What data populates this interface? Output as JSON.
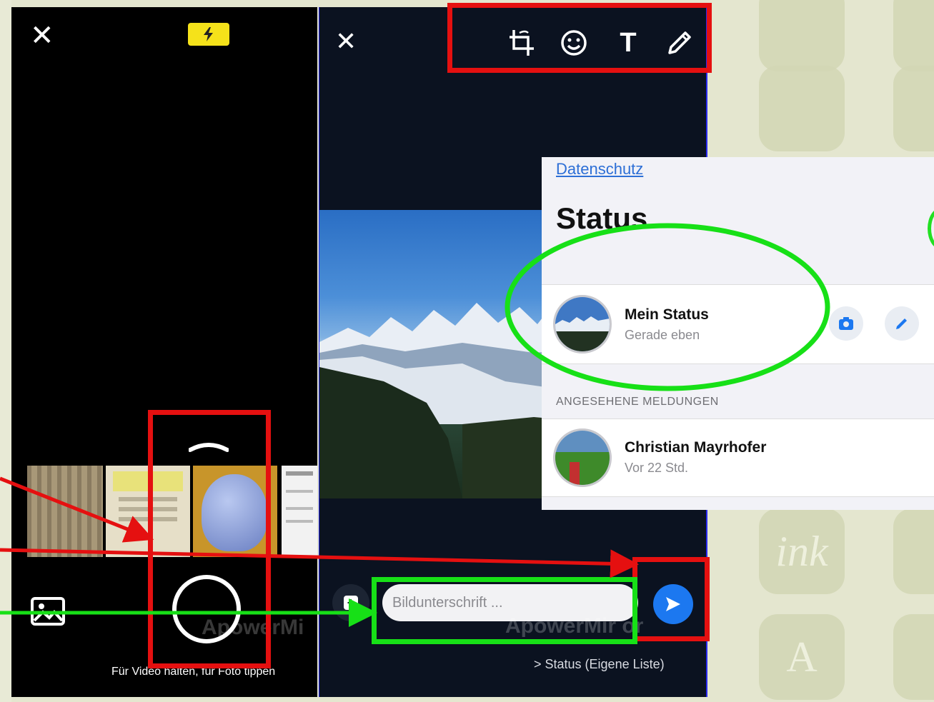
{
  "camera": {
    "close_icon": "close-icon",
    "flash_icon": "flash-icon",
    "hint": "Für Video halten, für Foto tippen",
    "watermark": "ApowerMi"
  },
  "editor": {
    "close_icon": "close-icon",
    "tools": [
      "crop-rotate-icon",
      "emoji-icon",
      "text-icon",
      "pencil-icon"
    ],
    "text_tool_label": "T",
    "caption_placeholder": "Bildunterschrift ...",
    "watermark": "ApowerMir or",
    "status_list": "> Status (Eigene Liste)"
  },
  "status_panel": {
    "privacy_link": "Datenschutz",
    "title": "Status",
    "my_status": {
      "name": "Mein Status",
      "time": "Gerade eben"
    },
    "section_header": "ANGESEHENE MELDUNGEN",
    "contacts": [
      {
        "name": "Christian Mayrhofer",
        "time": "Vor 22 Std."
      }
    ]
  },
  "background": {
    "tile_letters": [
      "ink",
      "A"
    ]
  },
  "colors": {
    "annotation_red": "#e51010",
    "annotation_green": "#17e017",
    "send_blue": "#1c78f0",
    "flash_yellow": "#f5e21a"
  }
}
